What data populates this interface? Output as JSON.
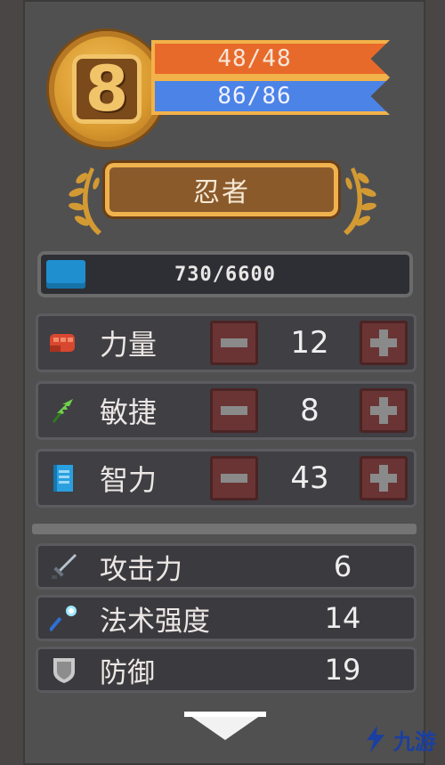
{
  "character": {
    "level": "8",
    "hp": "48/48",
    "mp": "86/86",
    "class_name": "忍者"
  },
  "xp": {
    "text": "730/6600",
    "current": 730,
    "max": 6600
  },
  "attributes": [
    {
      "label": "力量",
      "value": "12",
      "icon": "fist-icon"
    },
    {
      "label": "敏捷",
      "value": "8",
      "icon": "feather-icon"
    },
    {
      "label": "智力",
      "value": "43",
      "icon": "book-icon"
    }
  ],
  "derived_stats": [
    {
      "label": "攻击力",
      "value": "6",
      "icon": "sword-icon"
    },
    {
      "label": "法术强度",
      "value": "14",
      "icon": "staff-icon"
    },
    {
      "label": "防御",
      "value": "19",
      "icon": "shield-icon"
    }
  ],
  "watermark": {
    "text": "九游"
  },
  "colors": {
    "hp": "#e86a2a",
    "mp": "#4c83e6",
    "xp": "#1f8fd0",
    "gold": "#f0b24e",
    "button": "#6a3434"
  }
}
